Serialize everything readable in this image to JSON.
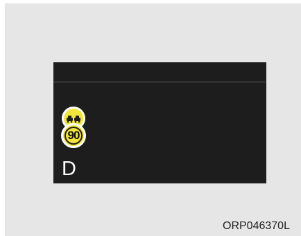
{
  "display": {
    "icons": {
      "no_overtaking": "no-overtaking-sign-icon",
      "speed_limit": "speed-limit-sign-icon"
    },
    "speed_limit_value": "90",
    "gear": "D"
  },
  "figure_code": "ORP046370L",
  "colors": {
    "background": "#e6e6e6",
    "display_background": "#1d1d1d",
    "sign_yellow": "#f2e53a"
  }
}
